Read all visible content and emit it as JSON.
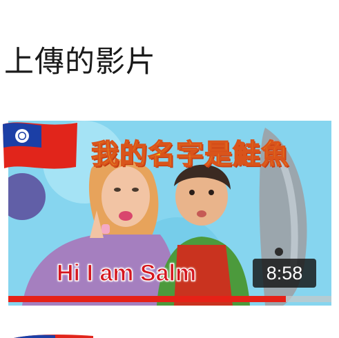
{
  "section": {
    "title": "上傳的影片"
  },
  "video": {
    "caption": "我的名字是鮭魚",
    "subtitle": "Hi I am Salm",
    "duration": "8:58",
    "progress_percent": 86
  },
  "icons": {
    "flag": "taiwan-flag-icon"
  },
  "colors": {
    "progress": "#e62117",
    "duration_badge": "#141414",
    "caption_text": "#f3d61c",
    "subtitle_text": "#d4161f"
  }
}
